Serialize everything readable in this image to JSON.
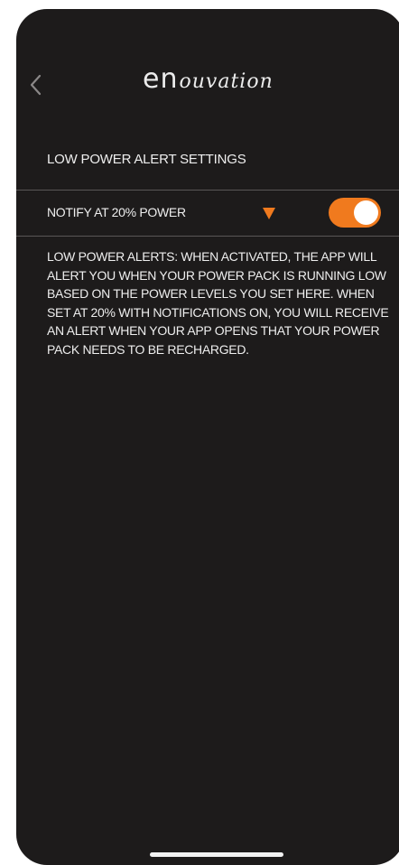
{
  "header": {
    "back_icon": "chevron-left-icon",
    "brand_prefix": "en",
    "brand_suffix": "ouvation"
  },
  "settings": {
    "section_title": "LOW POWER ALERT SETTINGS",
    "notify_row": {
      "label": "NOTIFY AT 20% POWER",
      "dropdown_icon": "triangle-down-icon",
      "toggle_on": true
    },
    "description": "LOW POWER ALERTS:  WHEN ACTIVATED, THE APP WILL ALERT YOU WHEN YOUR POWER PACK IS RUNNING LOW BASED ON THE POWER LEVELS YOU SET HERE.  WHEN SET AT 20% WITH NOTIFICATIONS ON, YOU WILL RECEIVE AN ALERT WHEN YOUR APP OPENS THAT YOUR POWER PACK NEEDS TO BE RECHARGED."
  },
  "colors": {
    "background": "#1d1b1b",
    "accent": "#f07a1e",
    "text": "#eeeeee",
    "divider": "#595656"
  }
}
